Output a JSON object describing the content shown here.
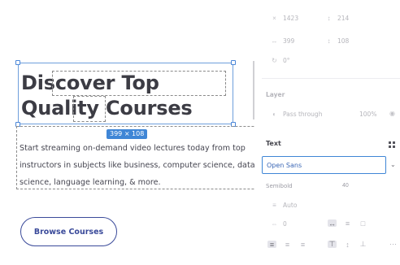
{
  "canvas": {
    "headline": "Discover Top Quality Courses",
    "size_badge": "399 × 108",
    "paragraph": "Start streaming on-demand video lectures today from top instructors in subjects like business, computer science, data science, language learning, & more.",
    "button_label": "Browse Courses"
  },
  "panel": {
    "top_rows": [
      {
        "a": "1423",
        "b": "214"
      },
      {
        "a": "399",
        "b": "108"
      },
      {
        "a": "0°",
        "b": ""
      }
    ],
    "layer_label": "Layer",
    "layer_mode": "Pass through",
    "layer_opacity": "100%",
    "text_section_title": "Text",
    "font_family": "Open Sans",
    "font_weight": "Semibold",
    "font_size": "40",
    "line_height": "Auto",
    "letter_spacing": "0",
    "accent_color": "#3f86d6"
  }
}
